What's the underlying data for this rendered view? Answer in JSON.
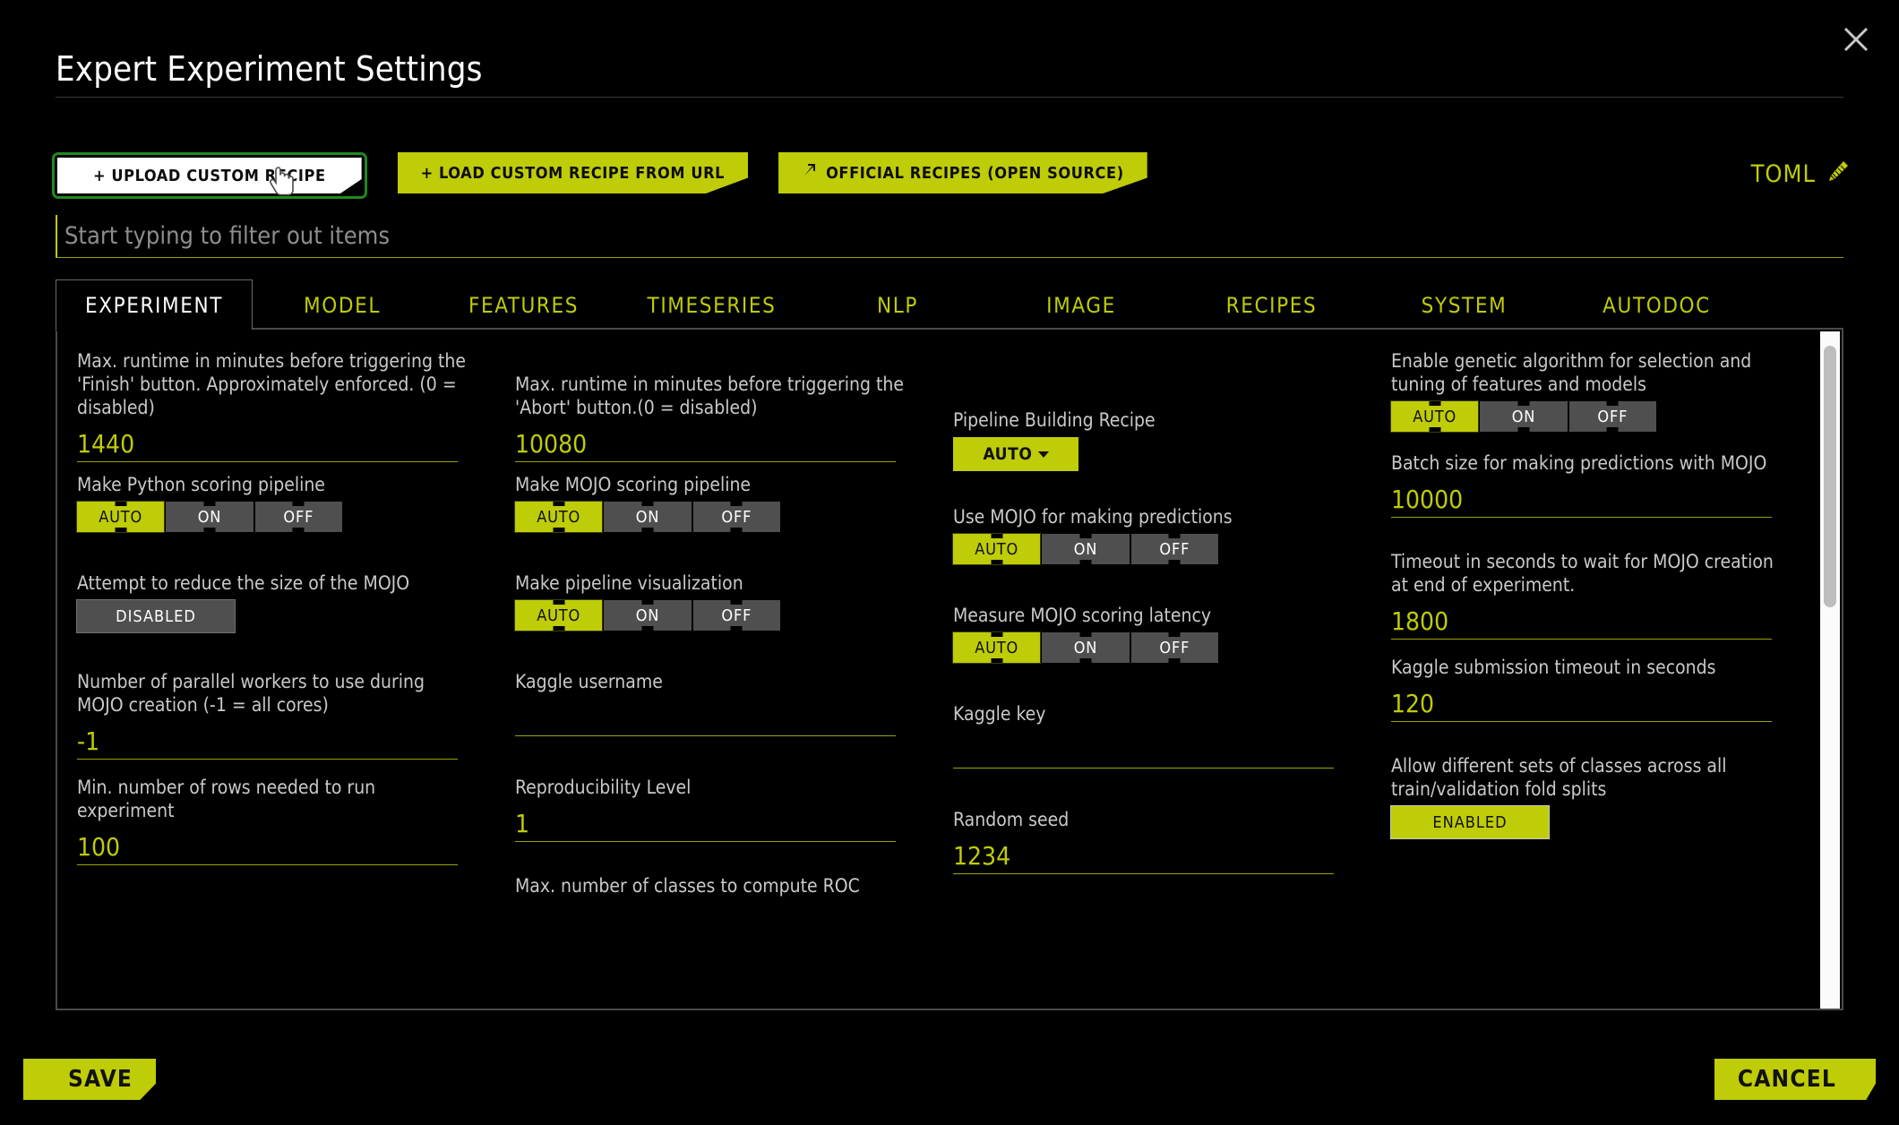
{
  "dialog": {
    "title": "Expert Experiment Settings",
    "close_icon": "close-icon"
  },
  "toolbar": {
    "upload_recipe": "+ UPLOAD CUSTOM RECIPE",
    "load_recipe_url": "+ LOAD CUSTOM RECIPE FROM URL",
    "official_recipes": "OFFICIAL RECIPES (OPEN SOURCE)",
    "toml_label": "TOML",
    "toml_icon": "pencil-icon",
    "external_link_icon": "external-link-icon"
  },
  "search": {
    "placeholder": "Start typing to filter out items",
    "value": ""
  },
  "tabs": [
    {
      "label": "EXPERIMENT",
      "active": true
    },
    {
      "label": "MODEL",
      "active": false
    },
    {
      "label": "FEATURES",
      "active": false
    },
    {
      "label": "TIMESERIES",
      "active": false
    },
    {
      "label": "NLP",
      "active": false
    },
    {
      "label": "IMAGE",
      "active": false
    },
    {
      "label": "RECIPES",
      "active": false
    },
    {
      "label": "SYSTEM",
      "active": false
    },
    {
      "label": "AUTODOC",
      "active": false
    }
  ],
  "toggle_options": {
    "auto": "AUTO",
    "on": "ON",
    "off": "OFF"
  },
  "columns": {
    "c1": {
      "f1": {
        "label": "Max. runtime in minutes before triggering the 'Finish' button. Approximately enforced. (0 = disabled)",
        "value": "1440"
      },
      "f2": {
        "label": "Make Python scoring pipeline",
        "selected": "AUTO"
      },
      "f3": {
        "label": "Attempt to reduce the size of the MOJO",
        "state": "DISABLED"
      },
      "f4": {
        "label": "Number of parallel workers to use during MOJO creation (-1 = all cores)",
        "value": "-1"
      },
      "f5": {
        "label": "Min. number of rows needed to run experiment",
        "value": "100"
      }
    },
    "c2": {
      "f1": {
        "label": "Max. runtime in minutes before triggering the 'Abort' button.(0 = disabled)",
        "value": "10080"
      },
      "f2": {
        "label": "Make MOJO scoring pipeline",
        "selected": "AUTO"
      },
      "f3": {
        "label": "Make pipeline visualization",
        "selected": "AUTO"
      },
      "f4": {
        "label": "Kaggle username",
        "value": ""
      },
      "f5": {
        "label": "Reproducibility Level",
        "value": "1"
      },
      "f6": {
        "label": "Max. number of classes to compute ROC"
      }
    },
    "c3": {
      "f1": {
        "label": "Pipeline Building Recipe",
        "value": "AUTO"
      },
      "f2": {
        "label": "Use MOJO for making predictions",
        "selected": "AUTO"
      },
      "f3": {
        "label": "Measure MOJO scoring latency",
        "selected": "AUTO"
      },
      "f4": {
        "label": "Kaggle key",
        "value": ""
      },
      "f5": {
        "label": "Random seed",
        "value": "1234"
      }
    },
    "c4": {
      "f1": {
        "label": "Enable genetic algorithm for selection and tuning of features and models",
        "selected": "AUTO"
      },
      "f2": {
        "label": "Batch size for making predictions with MOJO",
        "value": "10000"
      },
      "f3": {
        "label": "Timeout in seconds to wait for MOJO creation at end of experiment.",
        "value": "1800"
      },
      "f4": {
        "label": "Kaggle submission timeout in seconds",
        "value": "120"
      },
      "f5": {
        "label": "Allow different sets of classes across all train/validation fold splits",
        "state": "ENABLED"
      }
    }
  },
  "footer": {
    "save": "SAVE",
    "cancel": "CANCEL"
  },
  "colors": {
    "accent": "#bfcc08",
    "background": "#000000",
    "label_text": "#c9c9c9",
    "toggle_off": "#4f4f4f",
    "focus_outline": "#1f8a1f"
  }
}
